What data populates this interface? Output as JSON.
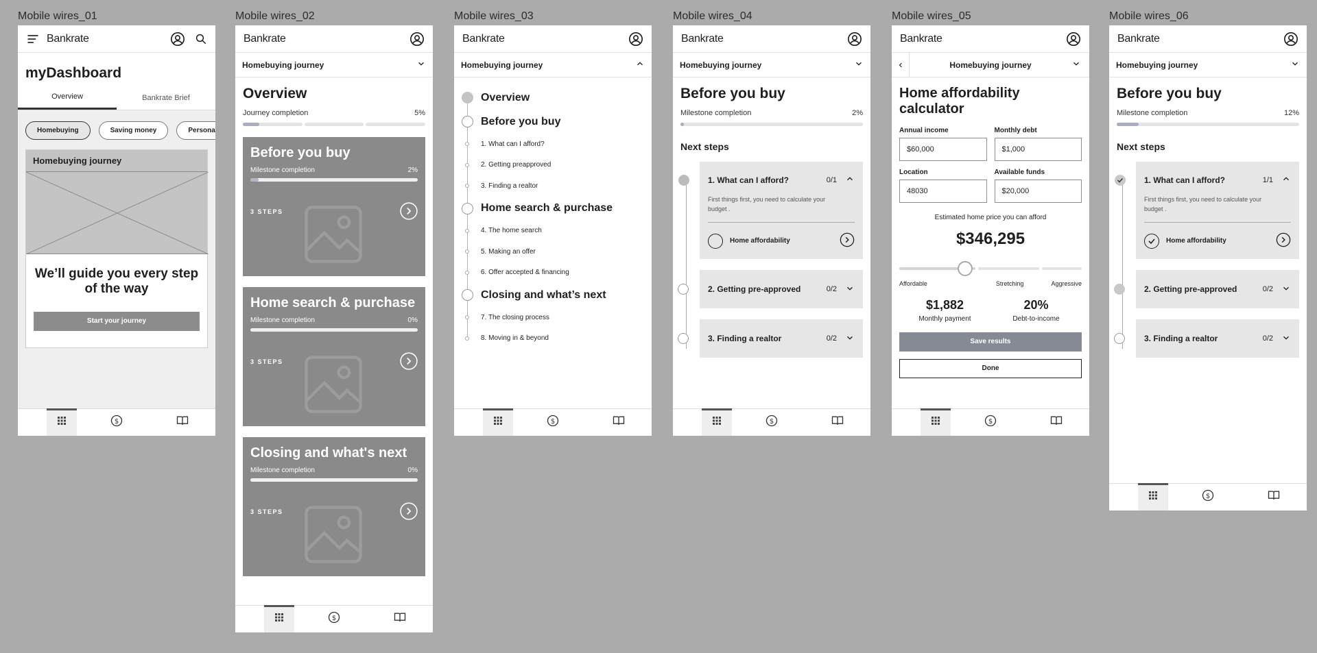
{
  "frames": {
    "f1": "Mobile wires_01",
    "f2": "Mobile wires_02",
    "f3": "Mobile wires_03",
    "f4": "Mobile wires_04",
    "f5": "Mobile wires_05",
    "f6": "Mobile wires_06"
  },
  "brand": "Bankrate",
  "journey_title": "Homebuying journey",
  "icons": [
    "menu-icon",
    "account-icon",
    "search-icon",
    "chevron-down-icon",
    "chevron-up-icon",
    "chevron-left-icon",
    "chevron-right-icon",
    "grid-icon",
    "dollar-icon",
    "book-icon",
    "image-placeholder-icon",
    "check-icon"
  ],
  "colors": {
    "canvas": "#ababab",
    "card": "#8a8a8a",
    "progress": "#a8aec0",
    "accordion": "#e6e6e6"
  },
  "w1": {
    "title": "myDashboard",
    "tabs": [
      "Overview",
      "Bankrate Brief"
    ],
    "chips": [
      "Homebuying",
      "Saving money",
      "Personal"
    ],
    "card_title": "Homebuying journey",
    "headline": "We’ll guide you every step of the way",
    "cta": "Start your journey"
  },
  "w2": {
    "title": "Overview",
    "progress_label": "Journey completion",
    "progress_value": "5%",
    "milestone_label": "Milestone completion",
    "steps_label": "3 STEPS",
    "cards": [
      {
        "title": "Before you buy",
        "value": "2%",
        "fill": 0.02
      },
      {
        "title": "Home search & purchase",
        "value": "0%",
        "fill": 0
      },
      {
        "title": "Closing and what's next",
        "value": "0%",
        "fill": 0
      }
    ]
  },
  "w3": {
    "items": [
      {
        "label": "Overview",
        "level": "major"
      },
      {
        "label": "Before you buy",
        "level": "major"
      },
      {
        "label": "1. What can I afford?",
        "level": "minor"
      },
      {
        "label": "2. Getting preapproved",
        "level": "minor"
      },
      {
        "label": "3. Finding a realtor",
        "level": "minor"
      },
      {
        "label": "Home search & purchase",
        "level": "major"
      },
      {
        "label": "4. The home search",
        "level": "minor"
      },
      {
        "label": "5. Making an offer",
        "level": "minor"
      },
      {
        "label": "6. Offer accepted & financing",
        "level": "minor"
      },
      {
        "label": "Closing and what’s next",
        "level": "major"
      },
      {
        "label": "7. The closing process",
        "level": "minor"
      },
      {
        "label": "8. Moving in & beyond",
        "level": "minor"
      }
    ]
  },
  "w4": {
    "title": "Before you buy",
    "milestone_label": "Milestone completion",
    "milestone_value": "2%",
    "milestone_fill": 0.02,
    "next_steps": "Next steps",
    "step1_title": "1. What can I afford?",
    "step1_count": "0/1",
    "step1_desc": "First things first, you need to calculate your budget .",
    "step1_task": "Home affordability",
    "step2_title": "2. Getting pre-approved",
    "step2_count": "0/2",
    "step3_title": "3. Finding a realtor",
    "step3_count": "0/2"
  },
  "w5": {
    "title": "Home affordability calculator",
    "annual_income_label": "Annual income",
    "annual_income": "$60,000",
    "monthly_debt_label": "Monthly debt",
    "monthly_debt": "$1,000",
    "location_label": "Location",
    "location": "48030",
    "available_funds_label": "Available funds",
    "available_funds": "$20,000",
    "estimate_label": "Estimated home price you can afford",
    "estimate": "$346,295",
    "slider_labels": [
      "Affordable",
      "Stretching",
      "Aggressive"
    ],
    "slider_value": 0.36,
    "monthly_payment": "$1,882",
    "monthly_payment_label": "Monthly payment",
    "dti": "20%",
    "dti_label": "Debt-to-income",
    "save": "Save results",
    "done": "Done"
  },
  "w6": {
    "title": "Before you buy",
    "milestone_label": "Milestone completion",
    "milestone_value": "12%",
    "milestone_fill": 0.12,
    "next_steps": "Next steps",
    "step1_title": "1. What can I afford?",
    "step1_count": "1/1",
    "step1_desc": "First things first, you need to calculate your budget .",
    "step1_task": "Home affordability",
    "step2_title": "2. Getting pre-approved",
    "step2_count": "0/2",
    "step3_title": "3. Finding a realtor",
    "step3_count": "0/2"
  }
}
